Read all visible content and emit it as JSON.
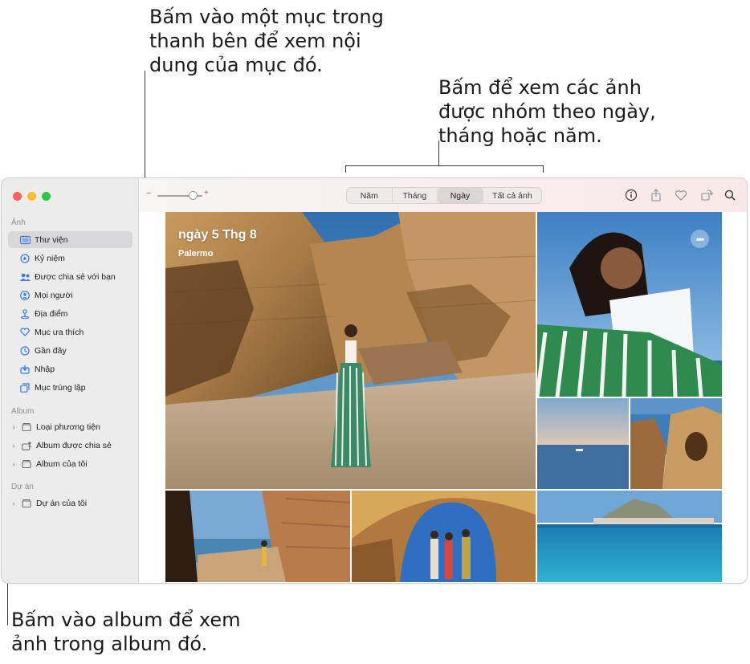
{
  "callouts": {
    "sidebar": [
      "Bấm vào một mục trong",
      "thanh bên để xem nội",
      "dung của mục đó."
    ],
    "view": [
      "Bấm để xem các ảnh",
      "được nhóm theo ngày,",
      "tháng hoặc năm."
    ],
    "album": [
      "Bấm vào album để xem",
      "ảnh trong album đó."
    ]
  },
  "sidebar": {
    "photos_section": "Ảnh",
    "items": [
      {
        "label": "Thư viện",
        "icon": "library-icon"
      },
      {
        "label": "Kỷ niệm",
        "icon": "memories-icon"
      },
      {
        "label": "Được chia sẻ với bạn",
        "icon": "shared-with-you-icon"
      },
      {
        "label": "Mọi người",
        "icon": "people-icon"
      },
      {
        "label": "Địa điểm",
        "icon": "places-icon"
      },
      {
        "label": "Mục ưa thích",
        "icon": "heart-icon"
      },
      {
        "label": "Gần đây",
        "icon": "recents-icon"
      },
      {
        "label": "Nhập",
        "icon": "import-icon"
      },
      {
        "label": "Mục trùng lặp",
        "icon": "duplicates-icon"
      }
    ],
    "album_section": "Album",
    "albums": [
      {
        "label": "Loại phương tiện",
        "icon": "folder-icon"
      },
      {
        "label": "Album được chia sẻ",
        "icon": "shared-album-icon"
      },
      {
        "label": "Album của tôi",
        "icon": "folder-icon"
      }
    ],
    "projects_section": "Dự án",
    "projects": [
      {
        "label": "Dự án của tôi",
        "icon": "folder-icon"
      }
    ]
  },
  "toolbar": {
    "zoom_minus": "−",
    "zoom_plus": "+",
    "zoom_level": 0.8,
    "tabs": [
      "Năm",
      "Tháng",
      "Ngày",
      "Tất cả ảnh"
    ],
    "active_tab": "Ngày",
    "icons": [
      "info-icon",
      "share-icon",
      "heart-icon",
      "rotate-icon",
      "search-icon"
    ]
  },
  "main": {
    "date_title": "ngày 5 Thg 8",
    "location": "Palermo",
    "more_label": "•••"
  },
  "colors": {
    "accent": "#3478f6",
    "close": "#fe5f57",
    "minimize": "#febc2e",
    "zoom": "#28c840"
  }
}
